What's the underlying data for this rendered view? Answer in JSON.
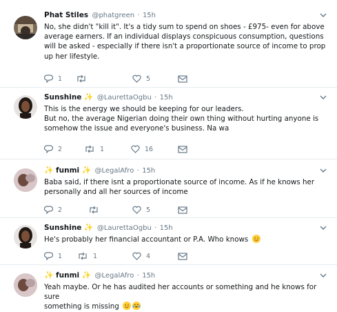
{
  "tweets": [
    {
      "name": "Phat Stiles",
      "handle": "@phatgreen",
      "time": "15h",
      "lines": [
        "No, she didn't \"kill it\". It's a tidy sum to spend on shoes - £975- even for above",
        "average earners. If an individual displays conspicuous consumption, questions",
        "will be asked - especially if there isn't a proportionate source of income to prop",
        "up her lifestyle."
      ],
      "replies": "1",
      "retweets": "",
      "likes": "5"
    },
    {
      "name": "Sunshine",
      "name_emoji": "sparkles-icon",
      "handle": "@LaurettaOgbu",
      "time": "15h",
      "lines": [
        "This is the energy we should be keeping for our leaders.",
        "But no, the average Nigerian doing their own thing without hurting anyone is",
        "somehow the issue and everyone's business. Na wa"
      ],
      "replies": "2",
      "retweets": "1",
      "likes": "16"
    },
    {
      "name": "funmi",
      "name_emoji": "sparkles-icon",
      "handle": "@LegalAfro",
      "time": "15h",
      "lines": [
        "Baba said, if there isnt a proportionate source of income. As if he knows her",
        "personally and all her sources of income"
      ],
      "replies": "2",
      "retweets": "",
      "likes": "5"
    },
    {
      "name": "Sunshine",
      "name_emoji": "sparkles-icon",
      "handle": "@LaurettaOgbu",
      "time": "15h",
      "lines": [
        "He's probably her financial accountant or P.A. Who knows"
      ],
      "trailing_emoji": [
        "slightly-smiling-face-icon"
      ],
      "replies": "1",
      "retweets": "1",
      "likes": "4"
    },
    {
      "name": "funmi",
      "name_emoji": "sparkles-icon",
      "handle": "@LegalAfro",
      "time": "15h",
      "lines": [
        "Yeah maybe. Or he has audited her accounts or something and he knows for sure",
        "something is missing"
      ],
      "trailing_emoji": [
        "slightly-smiling-face-icon",
        "face-with-tears-of-joy-icon"
      ]
    }
  ],
  "colors": {
    "text": "#14171a",
    "muted": "#657786",
    "divider": "#e6ecf0",
    "sparkle": "#f4b400",
    "emoji_yellow": "#ffcc33"
  }
}
